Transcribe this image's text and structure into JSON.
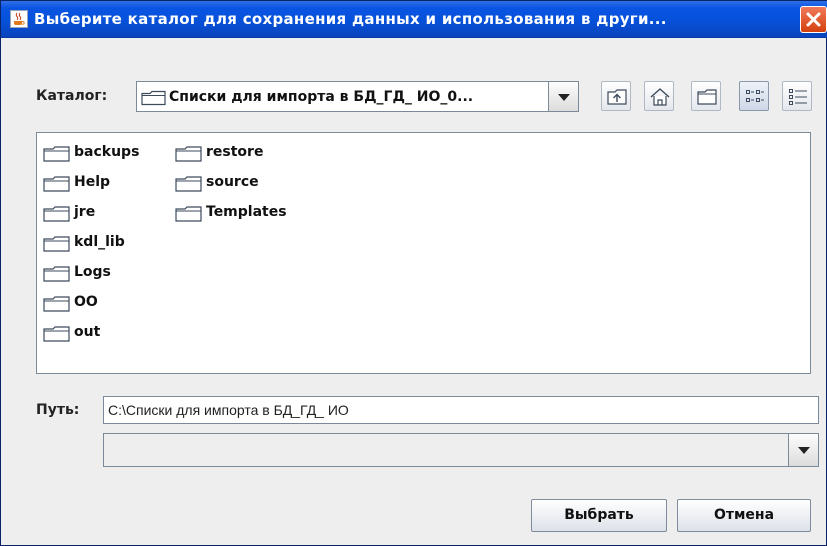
{
  "window": {
    "title": "Выберите каталог для сохранения данных и использования в други...",
    "title_icon": "java-cup-icon",
    "close_icon": "close-icon",
    "titlebar_color": "#0a54e3"
  },
  "lookin": {
    "label": "Каталог:",
    "value": "Списки для импорта в БД_ГД_ ИО_0..."
  },
  "toolbar": {
    "up_icon": "up-one-level-icon",
    "home_icon": "home-icon",
    "new_folder_icon": "new-folder-icon",
    "list_view_icon": "list-view-icon",
    "details_view_icon": "details-view-icon"
  },
  "files": {
    "column1": [
      "backups",
      "Help",
      "jre",
      "kdl_lib",
      "Logs",
      "OO",
      "out"
    ],
    "column2": [
      "restore",
      "source",
      "Templates"
    ]
  },
  "path": {
    "label": "Путь:",
    "value": "C:\\Списки для импорта в БД_ГД_ ИО"
  },
  "filter": {
    "value": ""
  },
  "buttons": {
    "select": "Выбрать",
    "cancel": "Отмена"
  }
}
